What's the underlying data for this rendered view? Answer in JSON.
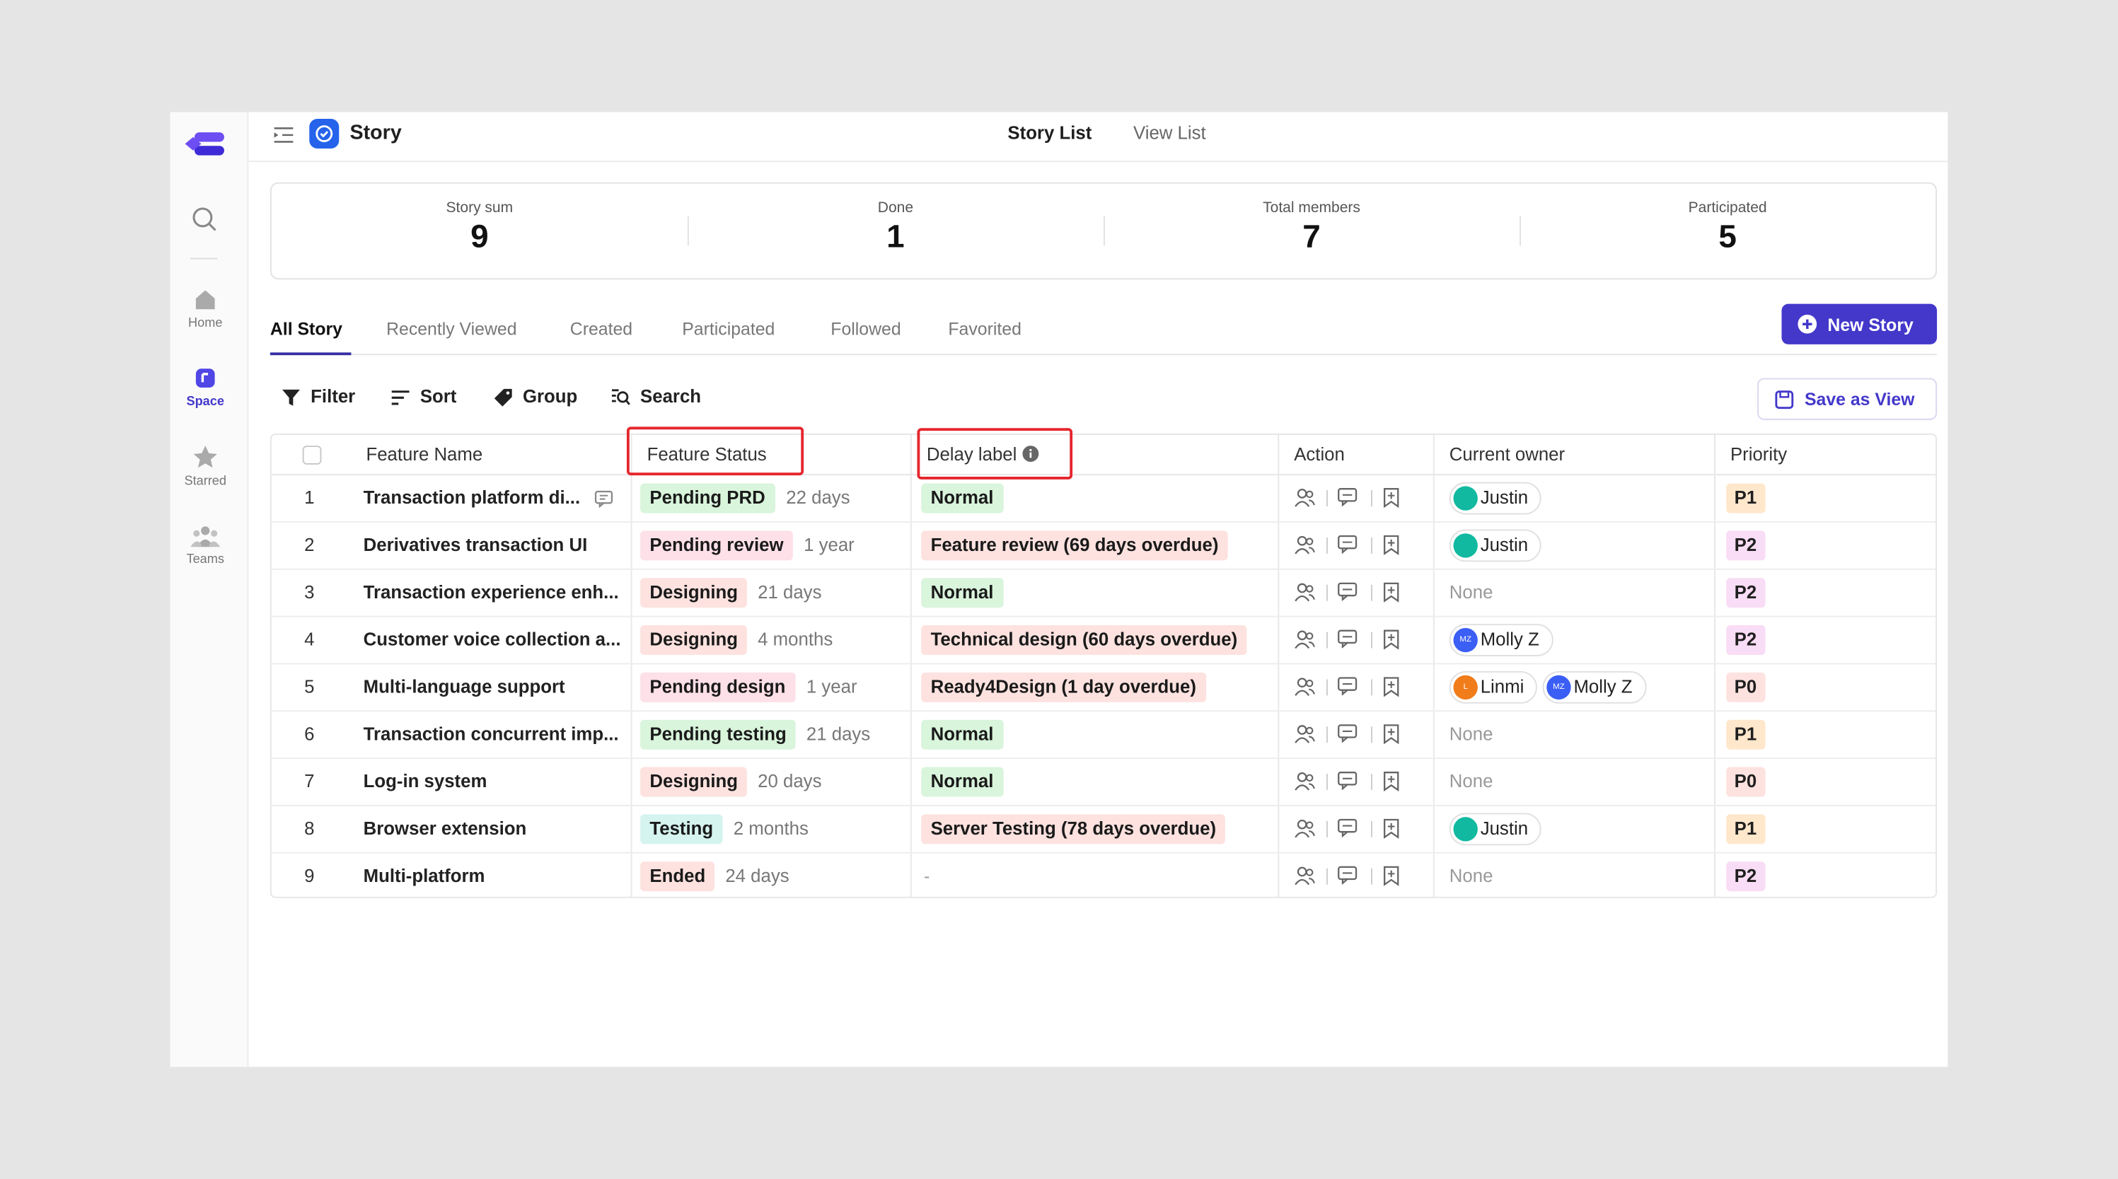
{
  "header": {
    "title": "Story",
    "tabs": [
      {
        "label": "Story List",
        "active": true
      },
      {
        "label": "View List",
        "active": false
      }
    ]
  },
  "sidebar": {
    "items": [
      {
        "label": "Home",
        "icon": "home-icon"
      },
      {
        "label": "Space",
        "icon": "space-icon",
        "active": true
      },
      {
        "label": "Starred",
        "icon": "star-icon"
      },
      {
        "label": "Teams",
        "icon": "teams-icon"
      }
    ]
  },
  "stats": [
    {
      "label": "Story sum",
      "value": "9"
    },
    {
      "label": "Done",
      "value": "1"
    },
    {
      "label": "Total members",
      "value": "7"
    },
    {
      "label": "Participated",
      "value": "5"
    }
  ],
  "tabs": [
    {
      "label": "All Story",
      "active": true
    },
    {
      "label": "Recently Viewed"
    },
    {
      "label": "Created"
    },
    {
      "label": "Participated"
    },
    {
      "label": "Followed"
    },
    {
      "label": "Favorited"
    }
  ],
  "new_story_label": "New Story",
  "toolbar": {
    "filter": "Filter",
    "sort": "Sort",
    "group": "Group",
    "search": "Search",
    "save_view": "Save as View"
  },
  "columns": {
    "feature_name": "Feature Name",
    "feature_status": "Feature Status",
    "delay_label": "Delay label",
    "action": "Action",
    "current_owner": "Current owner",
    "priority": "Priority"
  },
  "colors": {
    "accent": "#4338ca",
    "highlight": "#e5262d",
    "status_green_bg": "#d9f5dc",
    "status_pink_bg": "#fde0e8",
    "status_red_bg": "#fde2df",
    "status_teal_bg": "#d5f3ef"
  },
  "rows": [
    {
      "num": "1",
      "name": "Transaction platform di...",
      "has_comment": true,
      "status": "Pending PRD",
      "status_tone": "green",
      "duration": "22 days",
      "delay": "Normal",
      "delay_tone": "green",
      "owners": [
        {
          "name": "Justin",
          "avatar": "",
          "color": "#10b9a0"
        }
      ],
      "priority": "P1"
    },
    {
      "num": "2",
      "name": "Derivatives transaction UI",
      "status": "Pending review",
      "status_tone": "pink",
      "duration": "1 year",
      "delay": "Feature review (69 days overdue)",
      "delay_tone": "red",
      "owners": [
        {
          "name": "Justin",
          "avatar": "",
          "color": "#10b9a0"
        }
      ],
      "priority": "P2"
    },
    {
      "num": "3",
      "name": "Transaction experience enh...",
      "status": "Designing",
      "status_tone": "red",
      "duration": "21 days",
      "delay": "Normal",
      "delay_tone": "green",
      "owners": [],
      "none_label": "None",
      "priority": "P2"
    },
    {
      "num": "4",
      "name": "Customer voice collection a...",
      "status": "Designing",
      "status_tone": "red",
      "duration": "4 months",
      "delay": "Technical design (60 days overdue)",
      "delay_tone": "red",
      "owners": [
        {
          "name": "Molly Z",
          "avatar": "MZ",
          "color": "#3b5ef5"
        }
      ],
      "priority": "P2"
    },
    {
      "num": "5",
      "name": "Multi-language support",
      "status": "Pending design",
      "status_tone": "pink",
      "duration": "1 year",
      "delay": "Ready4Design (1 day overdue)",
      "delay_tone": "red",
      "owners": [
        {
          "name": "Linmi",
          "avatar": "L",
          "color": "#f07c1a"
        },
        {
          "name": "Molly Z",
          "avatar": "MZ",
          "color": "#3b5ef5"
        }
      ],
      "priority": "P0"
    },
    {
      "num": "6",
      "name": "Transaction concurrent imp...",
      "status": "Pending testing",
      "status_tone": "green",
      "duration": "21 days",
      "delay": "Normal",
      "delay_tone": "green",
      "owners": [],
      "none_label": "None",
      "priority": "P1"
    },
    {
      "num": "7",
      "name": "Log-in system",
      "status": "Designing",
      "status_tone": "red",
      "duration": "20 days",
      "delay": "Normal",
      "delay_tone": "green",
      "owners": [],
      "none_label": "None",
      "priority": "P0"
    },
    {
      "num": "8",
      "name": "Browser extension",
      "status": "Testing",
      "status_tone": "teal",
      "duration": "2 months",
      "delay": "Server Testing (78 days overdue)",
      "delay_tone": "red",
      "owners": [
        {
          "name": "Justin",
          "avatar": "",
          "color": "#10b9a0"
        }
      ],
      "priority": "P1"
    },
    {
      "num": "9",
      "name": "Multi-platform",
      "status": "Ended",
      "status_tone": "red",
      "duration": "24 days",
      "delay": "-",
      "delay_tone": "none",
      "owners": [],
      "none_label": "None",
      "priority": "P2"
    }
  ]
}
